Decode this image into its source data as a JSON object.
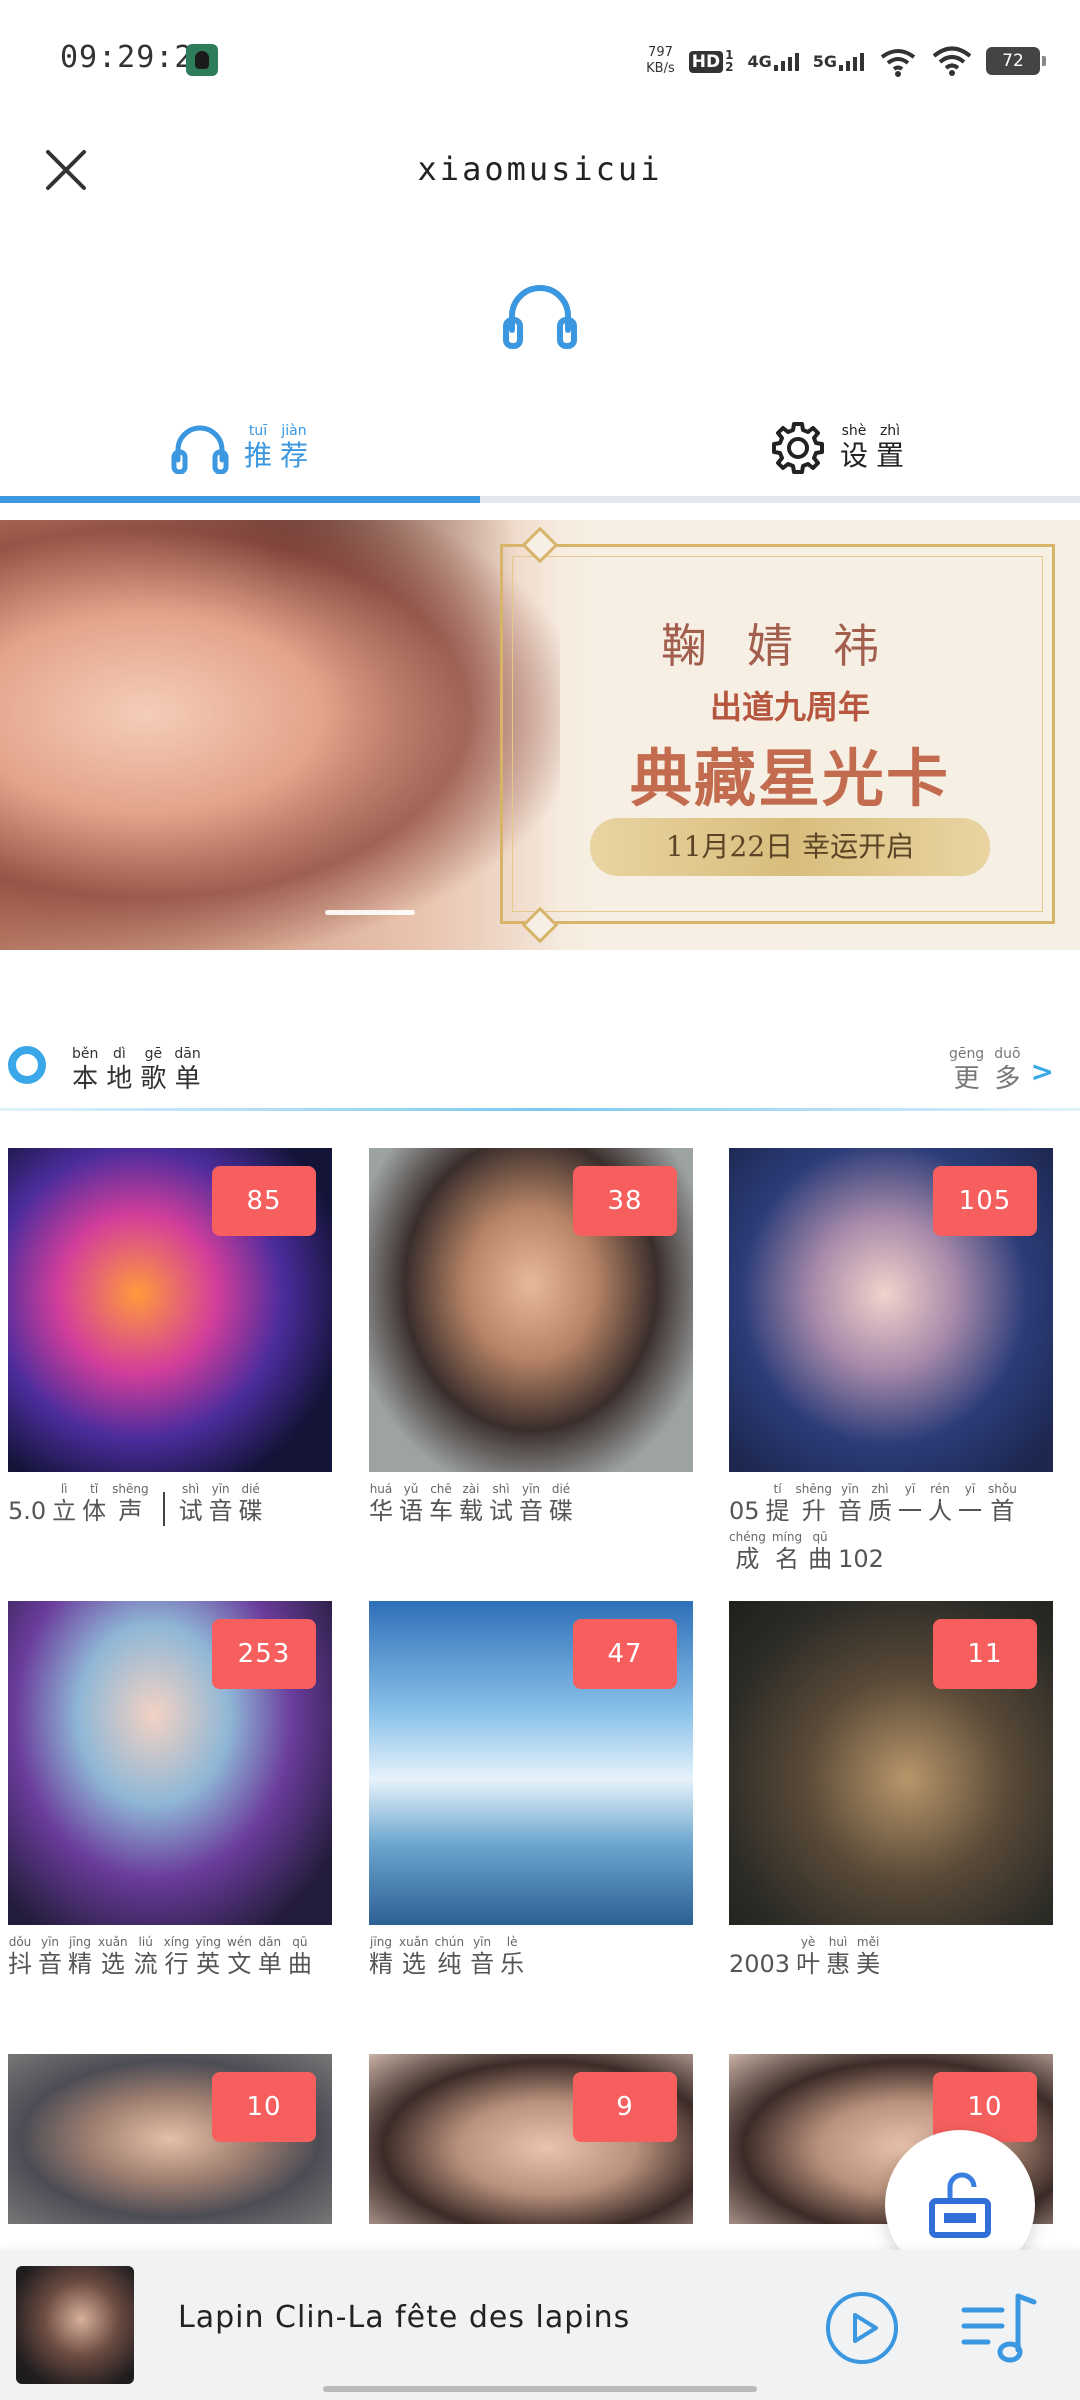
{
  "status_bar": {
    "time": "09:29:21",
    "net_speed_value": "797",
    "net_speed_unit": "KB/s",
    "hd_label": "HD",
    "sim1_index": "1",
    "sim2_index": "2",
    "net1": "4G",
    "net2": "5G",
    "battery": "72"
  },
  "header": {
    "title": "xiaomusicui"
  },
  "tabs": [
    {
      "label_chars": [
        "推",
        "荐"
      ],
      "pinyin": [
        "tuī",
        "jiàn"
      ],
      "active": true
    },
    {
      "label_chars": [
        "设",
        "置"
      ],
      "pinyin": [
        "shè",
        "zhì"
      ],
      "active": false
    }
  ],
  "banner": {
    "name": "鞠婧祎",
    "subtitle": "出道九周年",
    "main": "典藏星光卡",
    "date_text": "11月22日 幸运开启"
  },
  "section": {
    "title_chars": [
      "本",
      "地",
      "歌",
      "单"
    ],
    "title_pinyin": [
      "běn",
      "dì",
      "gē",
      "dān"
    ],
    "more_chars": [
      "更",
      "多"
    ],
    "more_pinyin": [
      "gēng",
      "duō"
    ],
    "more_arrow": ">"
  },
  "playlists": [
    {
      "count": "85",
      "prefix": "5.0",
      "chars": [
        "立",
        "体",
        "声"
      ],
      "pinyin": [
        "lì",
        "tǐ",
        "shēng"
      ],
      "chars2": [
        "试",
        "音",
        "碟"
      ],
      "pinyin2": [
        "shì",
        "yīn",
        "dié"
      ]
    },
    {
      "count": "38",
      "chars": [
        "华",
        "语",
        "车",
        "载",
        "试",
        "音",
        "碟"
      ],
      "pinyin": [
        "huá",
        "yǔ",
        "chē",
        "zài",
        "shì",
        "yīn",
        "dié"
      ]
    },
    {
      "count": "105",
      "prefix": "05",
      "chars": [
        "提",
        "升",
        "音",
        "质",
        "一",
        "人",
        "一",
        "首",
        "成",
        "名",
        "曲"
      ],
      "pinyin": [
        "tí",
        "shēng",
        "yīn",
        "zhì",
        "yī",
        "rén",
        "yī",
        "shǒu",
        "chéng",
        "míng",
        "qū"
      ],
      "suffix": "102"
    },
    {
      "count": "253",
      "chars": [
        "抖",
        "音",
        "精",
        "选",
        "流",
        "行",
        "英",
        "文",
        "单",
        "曲"
      ],
      "pinyin": [
        "dǒu",
        "yīn",
        "jīng",
        "xuǎn",
        "liú",
        "xíng",
        "yīng",
        "wén",
        "dān",
        "qū"
      ]
    },
    {
      "count": "47",
      "chars": [
        "精",
        "选",
        "纯",
        "音",
        "乐"
      ],
      "pinyin": [
        "jīng",
        "xuǎn",
        "chún",
        "yīn",
        "lè"
      ]
    },
    {
      "count": "11",
      "prefix": "2003",
      "chars": [
        "叶",
        "惠",
        "美"
      ],
      "pinyin": [
        "yè",
        "huì",
        "měi"
      ]
    },
    {
      "count": "10"
    },
    {
      "count": "9"
    },
    {
      "count": "10"
    }
  ],
  "player": {
    "now_playing": "Lapin Clin-La fête des lapins"
  },
  "colors": {
    "accent": "#3a97e0",
    "badge": "#f75f5f"
  }
}
